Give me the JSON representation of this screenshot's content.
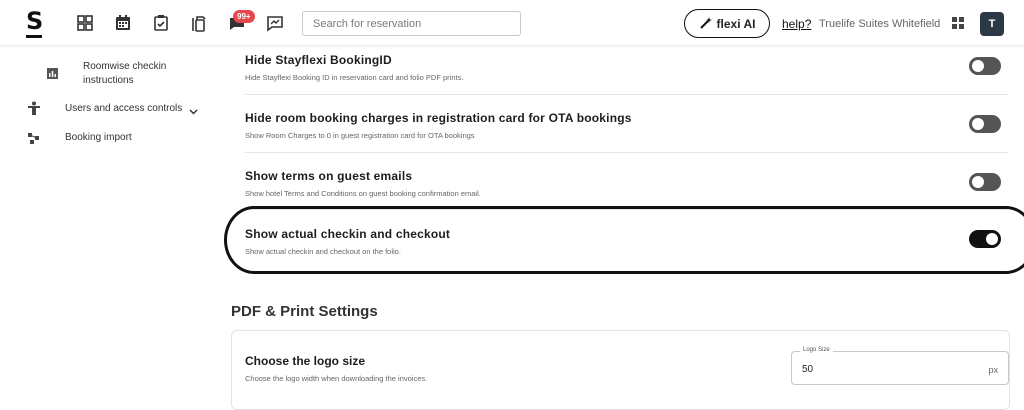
{
  "header": {
    "logo_text": "S",
    "badge_count": "99+",
    "search_placeholder": "Search for reservation",
    "flexi_ai_label": "flexi AI",
    "help_label": "help?",
    "hotel_name": "Truelife Suites Whitefield",
    "avatar_initial": "T",
    "nav_icons": [
      "dashboard-icon",
      "calendar-icon",
      "checklist-icon",
      "housekeeping-icon",
      "messages-icon",
      "reports-icon"
    ]
  },
  "sidebar": {
    "items": [
      {
        "label": "Roomwise checkin instructions",
        "icon": "report-icon"
      },
      {
        "label": "Users and access controls",
        "icon": "user-icon",
        "expandable": true
      },
      {
        "label": "Booking import",
        "icon": "import-icon"
      }
    ]
  },
  "settings": [
    {
      "title": "Hide Stayflexi BookingID",
      "description": "Hide Stayflexi Booking ID in reservation card and folio PDF prints.",
      "enabled": false
    },
    {
      "title": "Hide room booking charges in registration card for OTA bookings",
      "description": "Show Room Charges to 0 in guest registration card for OTA bookings",
      "enabled": false
    },
    {
      "title": "Show terms on guest emails",
      "description": "Show hotel Terms and Conditions on guest booking confirmation email.",
      "enabled": false
    },
    {
      "title": "Show actual checkin and checkout",
      "description": "Show actual checkin and checkout on the folio.",
      "enabled": true
    }
  ],
  "pdf_section": {
    "title": "PDF & Print Settings",
    "logo_size": {
      "title": "Choose the logo size",
      "description": "Choose the logo width when downloading the invoices.",
      "field_label": "Logo Size",
      "value": "50",
      "unit": "px"
    }
  },
  "colors": {
    "toggle_on": "#111111",
    "toggle_off": "#555555",
    "badge": "#e5484d",
    "avatar": "#2b3845"
  }
}
